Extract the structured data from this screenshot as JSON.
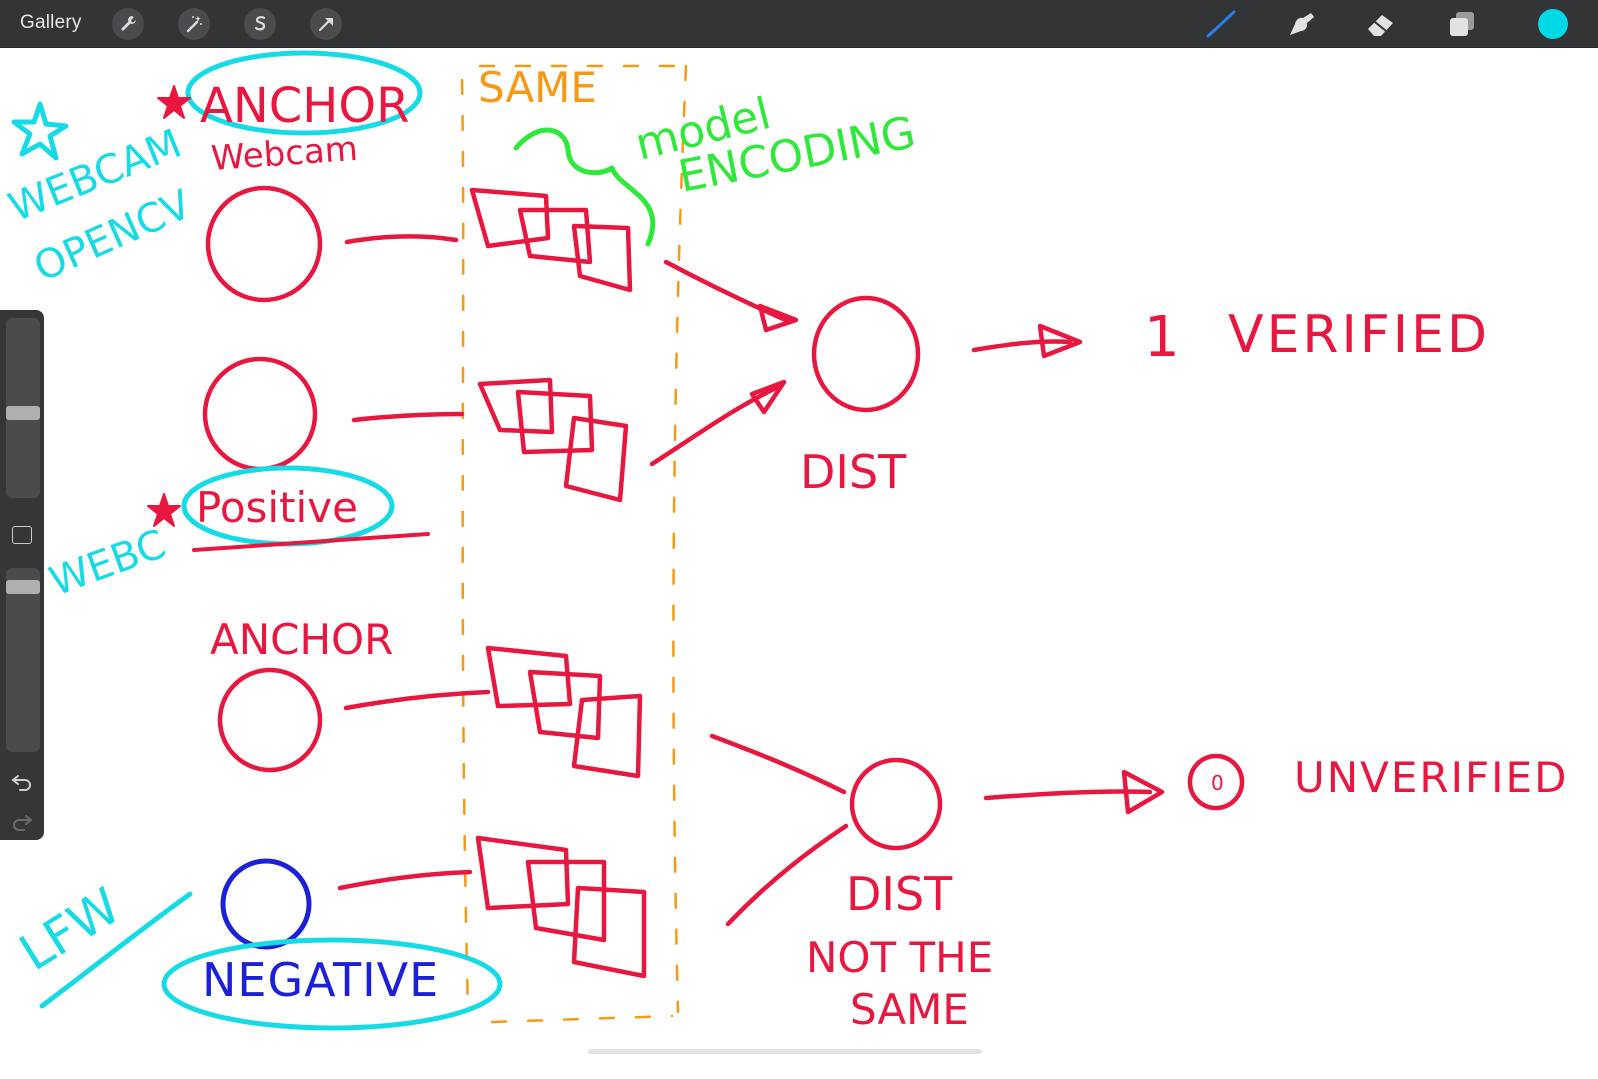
{
  "topbar": {
    "gallery_label": "Gallery",
    "left_tools": [
      "wrench-icon",
      "magic-wand-icon",
      "selection-icon",
      "transform-arrow-icon"
    ],
    "right_tools": [
      "brush-icon",
      "smudge-icon",
      "eraser-icon",
      "layers-icon"
    ],
    "current_color": "#00d8e6"
  },
  "colors": {
    "red_ink": "#e8173f",
    "cyan_ink": "#16dbe6",
    "orange_ink": "#f59a16",
    "green_ink": "#2ee83a",
    "blue_ink": "#1c20d6"
  },
  "drawing": {
    "same": "SAME",
    "model": "model",
    "encoding": "ENCODING",
    "anchor_top": "ANCHOR",
    "webcam": "Webcam",
    "webcam_cyan": "WEBCAM",
    "opencv": "OPENCV",
    "positive": "Positive",
    "webc": "WEBC",
    "anchor_bottom": "ANCHOR",
    "negative": "NEGATIVE",
    "lfw": "LFW",
    "dist_top": "DIST",
    "one": "1",
    "verified": "VERIFIED",
    "dist_bottom": "DIST",
    "not_the": "NOT THE",
    "same_bottom": "SAME",
    "zero": "0",
    "unverified": "UNVERIFIED"
  }
}
